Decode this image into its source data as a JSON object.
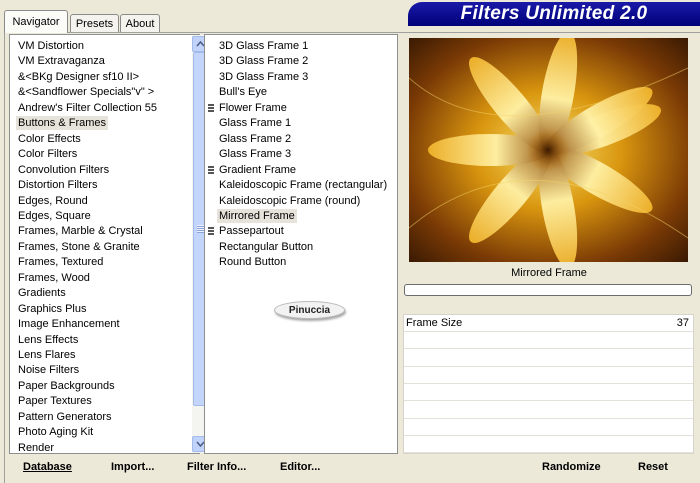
{
  "title": "Filters Unlimited 2.0",
  "tabs": [
    {
      "label": "Navigator"
    },
    {
      "label": "Presets"
    },
    {
      "label": "About"
    }
  ],
  "categories": [
    "VM Distortion",
    "VM Extravaganza",
    "&<BKg Designer sf10 II>",
    "&<Sandflower Specials\"v\" >",
    "Andrew's Filter Collection 55",
    "Buttons & Frames",
    "Color Effects",
    "Color Filters",
    "Convolution Filters",
    "Distortion Filters",
    "Edges, Round",
    "Edges, Square",
    "Frames, Marble & Crystal",
    "Frames, Stone & Granite",
    "Frames, Textured",
    "Frames, Wood",
    "Gradients",
    "Graphics Plus",
    "Image Enhancement",
    "Lens Effects",
    "Lens Flares",
    "Noise Filters",
    "Paper Backgrounds",
    "Paper Textures",
    "Pattern Generators",
    "Photo Aging Kit",
    "Render"
  ],
  "selected_category": "Buttons & Frames",
  "filters": [
    {
      "label": "3D Glass Frame 1",
      "icon": false
    },
    {
      "label": "3D Glass Frame 2",
      "icon": false
    },
    {
      "label": "3D Glass Frame 3",
      "icon": false
    },
    {
      "label": "Bull's Eye",
      "icon": false
    },
    {
      "label": "Flower Frame",
      "icon": true
    },
    {
      "label": "Glass Frame 1",
      "icon": false
    },
    {
      "label": "Glass Frame 2",
      "icon": false
    },
    {
      "label": "Glass Frame 3",
      "icon": false
    },
    {
      "label": "Gradient Frame",
      "icon": true
    },
    {
      "label": "Kaleidoscopic Frame (rectangular)",
      "icon": false
    },
    {
      "label": "Kaleidoscopic Frame (round)",
      "icon": false
    },
    {
      "label": "Mirrored Frame",
      "icon": false
    },
    {
      "label": "Passepartout",
      "icon": true
    },
    {
      "label": "Rectangular Button",
      "icon": false
    },
    {
      "label": "Round Button",
      "icon": false
    }
  ],
  "selected_filter": "Mirrored Frame",
  "logo_text": "Pinuccia",
  "preview_label": "Mirrored Frame",
  "progress": 0,
  "params": [
    {
      "label": "Frame Size",
      "value": "37"
    }
  ],
  "buttons": {
    "database": "Database",
    "import": "Import...",
    "filter_info": "Filter Info...",
    "editor": "Editor...",
    "randomize": "Randomize",
    "reset": "Reset"
  },
  "colors": {
    "title_bar": "#00007a",
    "window_bg": "#ece9d8",
    "scroll_accent": "#c1d3fb"
  }
}
